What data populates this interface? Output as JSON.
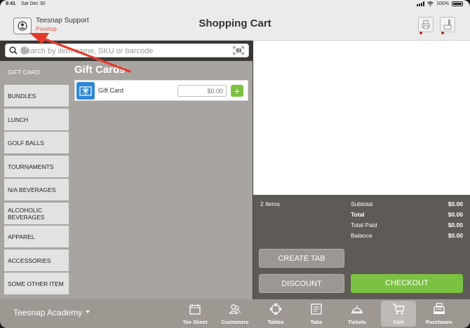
{
  "status_bar": {
    "time": "9:41",
    "date": "Sat Dec 30",
    "battery": "100%"
  },
  "header": {
    "user_name": "Teesnap Support",
    "user_role": "Proshop",
    "title": "Shopping Cart",
    "icons": [
      "printer-icon",
      "cash-drawer-icon"
    ]
  },
  "search": {
    "placeholder": "Search by item name, SKU or barcode",
    "value": ""
  },
  "categories": [
    {
      "label": "GIFT CARD",
      "active": true
    },
    {
      "label": "BUNDLES"
    },
    {
      "label": "LUNCH"
    },
    {
      "label": "GOLF BALLS"
    },
    {
      "label": "TOURNAMENTS"
    },
    {
      "label": "N/A BEVERAGES"
    },
    {
      "label": "ALCOHOLIC BEVERAGES"
    },
    {
      "label": "APPAREL"
    },
    {
      "label": "ACCESSORIES"
    },
    {
      "label": "SOME OTHER ITEM"
    }
  ],
  "products": {
    "title": "Gift Cards",
    "items": [
      {
        "name": "Gift Card",
        "price_placeholder": "$0.00",
        "add_label": "+"
      }
    ]
  },
  "summary": {
    "items_count": "2 Items",
    "rows": [
      {
        "label": "Subtotal",
        "value": "$0.00",
        "bold": false
      },
      {
        "label": "Total",
        "value": "$0.00",
        "bold": true
      },
      {
        "label": "Total Paid",
        "value": "$0.00",
        "bold": false
      },
      {
        "label": "Balance",
        "value": "$0.00",
        "bold": false
      }
    ],
    "create_tab_label": "CREATE TAB",
    "discount_label": "DISCOUNT",
    "checkout_label": "CHECKOUT"
  },
  "footer": {
    "location": "Teesnap Academy",
    "tabs": [
      {
        "label": "Tee Sheet",
        "icon": "calendar-icon"
      },
      {
        "label": "Customers",
        "icon": "customers-icon"
      },
      {
        "label": "Tables",
        "icon": "tables-icon"
      },
      {
        "label": "Tabs",
        "icon": "tabs-icon"
      },
      {
        "label": "Tickets",
        "icon": "tickets-icon"
      },
      {
        "label": "Cart",
        "icon": "cart-icon",
        "active": true
      },
      {
        "label": "Purchases",
        "icon": "register-icon"
      }
    ]
  },
  "colors": {
    "accent_green": "#7cc242",
    "role_red": "#d25c4a",
    "arrow_red": "#e53a2a",
    "product_icon_blue": "#2f87d6"
  }
}
